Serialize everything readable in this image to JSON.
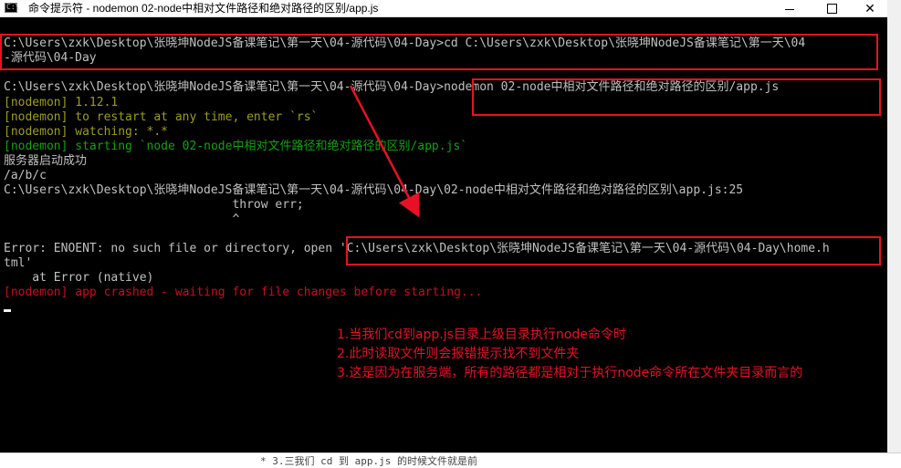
{
  "window": {
    "title": "命令提示符 - nodemon  02-node中相对文件路径和绝对路径的区别/app.js",
    "icon_label": "C:\\",
    "buttons": {
      "minimize": "minimize-icon",
      "maximize": "maximize-icon",
      "close": "✕"
    }
  },
  "console": {
    "lines": [
      "C:\\Users\\zxk\\Desktop\\张晓坤NodeJS备课笔记\\第一天\\04-源代码\\04-Day>cd C:\\Users\\zxk\\Desktop\\张晓坤NodeJS备课笔记\\第一天\\04",
      "-源代码\\04-Day",
      "",
      "C:\\Users\\zxk\\Desktop\\张晓坤NodeJS备课笔记\\第一天\\04-源代码\\04-Day>nodemon 02-node中相对文件路径和绝对路径的区别/app.js",
      "[nodemon] 1.12.1",
      "[nodemon] to restart at any time, enter `rs`",
      "[nodemon] watching: *.*",
      "[nodemon] starting `node 02-node中相对文件路径和绝对路径的区别/app.js`",
      "服务器启动成功",
      "/a/b/c",
      "C:\\Users\\zxk\\Desktop\\张晓坤NodeJS备课笔记\\第一天\\04-源代码\\04-Day\\02-node中相对文件路径和绝对路径的区别\\app.js:25",
      "                                throw err;",
      "                                ^",
      "",
      "Error: ENOENT: no such file or directory, open 'C:\\Users\\zxk\\Desktop\\张晓坤NodeJS备课笔记\\第一天\\04-源代码\\04-Day\\home.h",
      "tml'",
      "    at Error (native)",
      "[nodemon] app crashed - waiting for file changes before starting..."
    ]
  },
  "notes": [
    "1.当我们cd到app.js目录上级目录执行node命令时",
    "2.此时读取文件则会报错提示找不到文件夹",
    "3.这是因为在服务端，所有的路径都是相对于执行node命令所在文件夹目录而言的"
  ],
  "background_text": "* 3.三我们 cd 到 app.js 的时候文件就是前"
}
